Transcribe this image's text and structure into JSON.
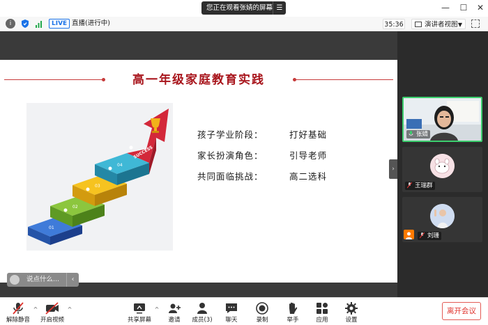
{
  "titlebar": {
    "share_notice": "您正在观看张婧的屏幕",
    "menu_glyph": "☰",
    "minimize": "—",
    "maximize": "☐",
    "close": "✕"
  },
  "infobar": {
    "live_badge": "LIVE",
    "live_status": "直播(进行中)",
    "timer": "35:36",
    "view_mode": "演讲者视图"
  },
  "slide": {
    "title": "高一年级家庭教育实践",
    "stair_labels": [
      "01",
      "02",
      "03",
      "04"
    ],
    "success_label": "SUCCESS",
    "bullets": [
      {
        "key": "孩子学业阶段：",
        "value": "打好基础"
      },
      {
        "key": "家长扮演角色：",
        "value": "引导老师"
      },
      {
        "key": "共同面临挑战：",
        "value": "高二选科"
      }
    ]
  },
  "chat": {
    "placeholder": "说点什么..."
  },
  "participants": [
    {
      "name": "张婧",
      "active": true
    },
    {
      "name": "王瑞群",
      "active": false
    },
    {
      "name": "刘珊",
      "active": false
    }
  ],
  "toolbar": {
    "unmute": "解除静音",
    "start_video": "开启视频",
    "share_screen": "共享屏幕",
    "invite": "邀请",
    "members": "成员(3)",
    "chat": "聊天",
    "record": "录制",
    "raise_hand": "举手",
    "apps": "应用",
    "settings": "设置",
    "leave": "离开会议"
  },
  "colors": {
    "title_red": "#a8151c",
    "active_green": "#3ccf6e",
    "leave_red": "#e0322c",
    "live_blue": "#1a73e8"
  }
}
